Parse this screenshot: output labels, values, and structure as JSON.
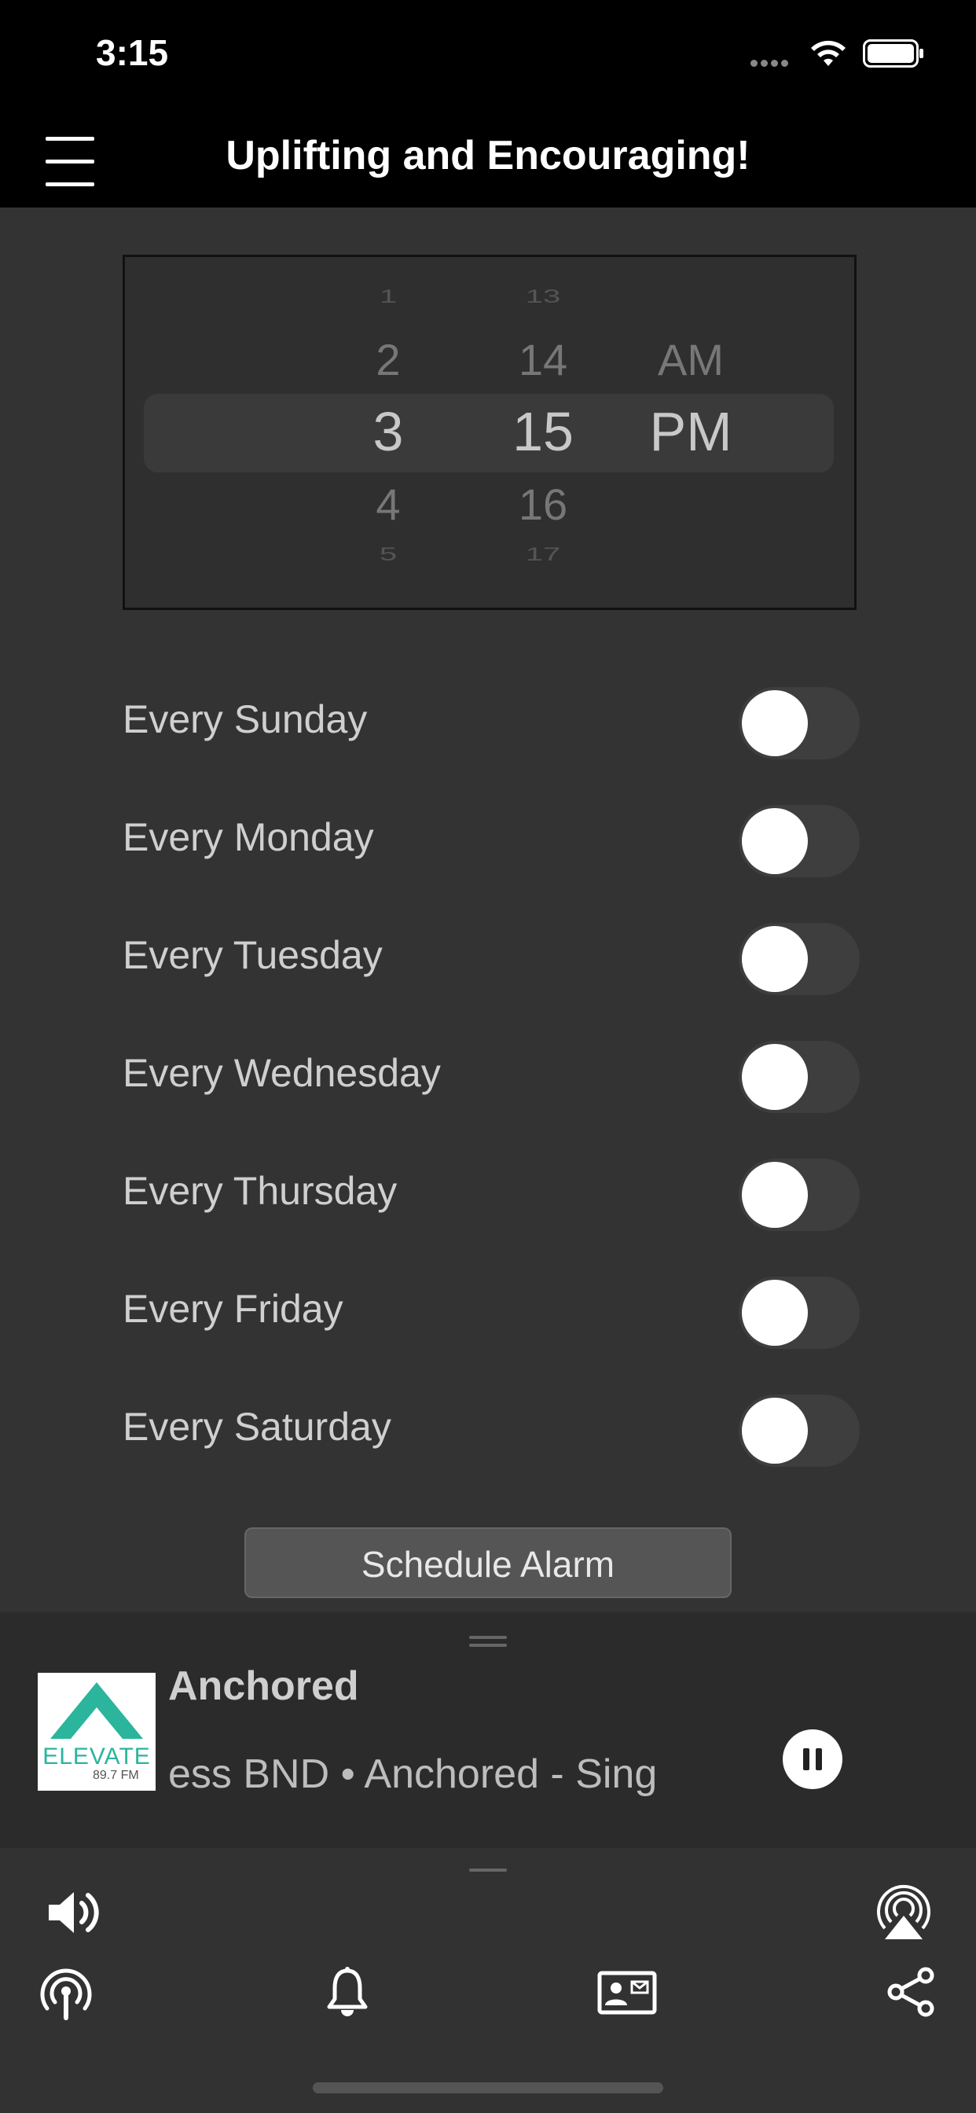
{
  "status_bar": {
    "time": "3:15"
  },
  "header": {
    "title": "Uplifting and Encouraging!"
  },
  "time_picker": {
    "hours": [
      "1",
      "2",
      "3",
      "4",
      "5"
    ],
    "minutes": [
      "13",
      "14",
      "15",
      "16",
      "17"
    ],
    "periods": [
      "AM",
      "PM"
    ],
    "selected": {
      "hour": "3",
      "minute": "15",
      "period": "PM"
    }
  },
  "days": [
    {
      "label": "Every Sunday",
      "on": false
    },
    {
      "label": "Every Monday",
      "on": false
    },
    {
      "label": "Every Tuesday",
      "on": false
    },
    {
      "label": "Every Wednesday",
      "on": false
    },
    {
      "label": "Every Thursday",
      "on": false
    },
    {
      "label": "Every Friday",
      "on": false
    },
    {
      "label": "Every Saturday",
      "on": false
    }
  ],
  "schedule_button": {
    "label": "Schedule Alarm"
  },
  "now_playing": {
    "title": "Anchored",
    "meta": "ess BND • Anchored - Sing",
    "logo_text": "ELEVATE",
    "logo_freq": "89.7 FM",
    "state": "playing"
  },
  "colors": {
    "background": "#333333",
    "bars": "#000000",
    "logo_teal": "#2ab59c",
    "toggle_track": "#3e3e3e"
  },
  "toolbar": {
    "top": [
      "speaker-icon",
      "airplay-icon"
    ],
    "bottom": [
      "podcast-icon",
      "bell-icon",
      "contact-card-icon",
      "share-icon"
    ]
  }
}
